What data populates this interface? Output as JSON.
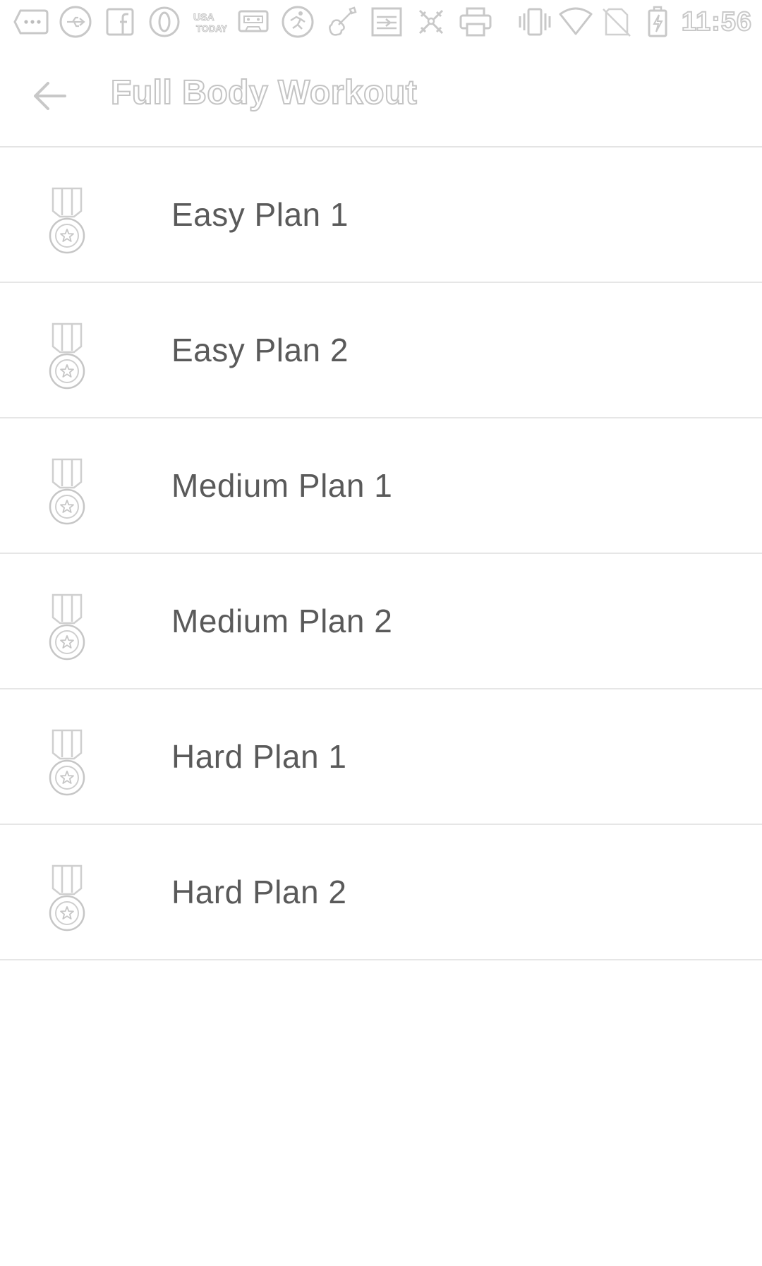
{
  "status_bar": {
    "notification_icons": [
      "more-dots-icon",
      "usb-icon",
      "facebook-icon",
      "opera-icon",
      "usa-today-icon",
      "cassette-icon",
      "fitness-run-icon",
      "violin-icon",
      "transfer-icon",
      "sports-icon",
      "printer-icon"
    ],
    "system_icons": [
      "vibrate-icon",
      "wifi-icon",
      "no-sim-icon",
      "battery-charging-icon"
    ],
    "time": "11:56"
  },
  "app_bar": {
    "back_icon": "arrow-left-icon",
    "title": "Full Body Workout"
  },
  "plans": [
    {
      "label": "Easy Plan 1",
      "icon": "medal-icon"
    },
    {
      "label": "Easy Plan 2",
      "icon": "medal-icon"
    },
    {
      "label": "Medium Plan 1",
      "icon": "medal-icon"
    },
    {
      "label": "Medium Plan 2",
      "icon": "medal-icon"
    },
    {
      "label": "Hard Plan 1",
      "icon": "medal-icon"
    },
    {
      "label": "Hard Plan 2",
      "icon": "medal-icon"
    }
  ],
  "colors": {
    "background": "#ffffff",
    "text": "#5a5a5a",
    "divider": "#e6e6e6",
    "icon_outline": "#c8c8c8"
  }
}
